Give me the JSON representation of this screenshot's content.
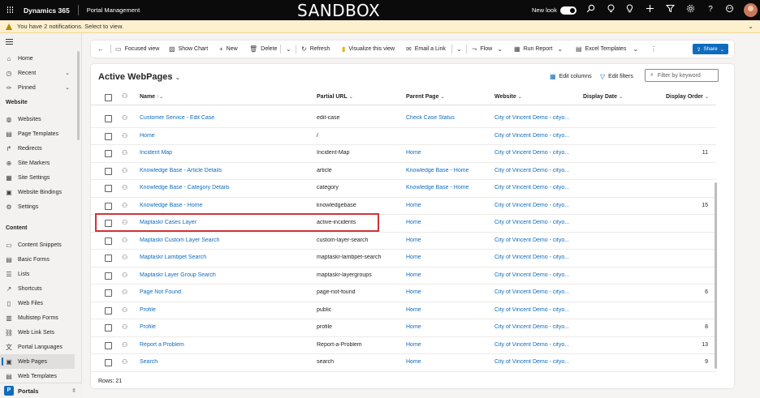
{
  "topbar": {
    "brand": "Dynamics 365",
    "app_name": "Portal Management",
    "environment": "SANDBOX",
    "new_look_label": "New look",
    "new_look_on": true
  },
  "notification": {
    "text": "You have 2 notifications. Select to view."
  },
  "sidebar": {
    "top_items": [
      {
        "label": "Home",
        "icon": "home-icon"
      },
      {
        "label": "Recent",
        "icon": "clock-icon"
      },
      {
        "label": "Pinned",
        "icon": "pin-icon"
      }
    ],
    "website_header": "Website",
    "website_items": [
      {
        "label": "Websites",
        "icon": "globe-icon"
      },
      {
        "label": "Page Templates",
        "icon": "document-icon"
      },
      {
        "label": "Redirects",
        "icon": "redirect-icon"
      },
      {
        "label": "Site Markers",
        "icon": "marker-icon"
      },
      {
        "label": "Site Settings",
        "icon": "settings-icon"
      },
      {
        "label": "Website Bindings",
        "icon": "binding-icon"
      },
      {
        "label": "Settings",
        "icon": "gear-icon"
      }
    ],
    "content_header": "Content",
    "content_items": [
      {
        "label": "Content Snippets",
        "icon": "snippet-icon"
      },
      {
        "label": "Basic Forms",
        "icon": "form-icon"
      },
      {
        "label": "Lists",
        "icon": "list-icon"
      },
      {
        "label": "Shortcuts",
        "icon": "shortcut-icon"
      },
      {
        "label": "Web Files",
        "icon": "file-icon"
      },
      {
        "label": "Multistep Forms",
        "icon": "multistep-icon"
      },
      {
        "label": "Web Link Sets",
        "icon": "link-icon"
      },
      {
        "label": "Portal Languages",
        "icon": "language-icon"
      },
      {
        "label": "Web Pages",
        "icon": "webpage-icon",
        "selected": true
      },
      {
        "label": "Web Templates",
        "icon": "template-icon"
      }
    ],
    "area_badge": "P",
    "area_label": "Portals"
  },
  "commandbar": {
    "focused_view": "Focused view",
    "show_chart": "Show Chart",
    "new": "New",
    "delete": "Delete",
    "refresh": "Refresh",
    "visualize": "Visualize this view",
    "email_link": "Email a Link",
    "flow": "Flow",
    "run_report": "Run Report",
    "excel_templates": "Excel Templates",
    "share": "Share"
  },
  "view": {
    "title": "Active WebPages",
    "edit_columns": "Edit columns",
    "edit_filters": "Edit filters",
    "filter_placeholder": "Filter by keyword",
    "columns": [
      "Name",
      "Partial URL",
      "Parent Page",
      "Website",
      "Display Date",
      "Display Order"
    ],
    "rows": [
      {
        "name": "Customer Service - Edit Case",
        "url": "edit-case",
        "parent": "Check Case Status",
        "website": "City of Vincent Demo - cityo...",
        "date": "",
        "order": ""
      },
      {
        "name": "Home",
        "url": "/",
        "parent": "",
        "website": "City of Vincent Demo - cityo...",
        "date": "",
        "order": ""
      },
      {
        "name": "Incident Map",
        "url": "Incident-Map",
        "parent": "Home",
        "website": "City of Vincent Demo - cityo...",
        "date": "",
        "order": "11"
      },
      {
        "name": "Knowledge Base - Article Details",
        "url": "article",
        "parent": "Knowledge Base - Home",
        "website": "City of Vincent Demo - cityo...",
        "date": "",
        "order": ""
      },
      {
        "name": "Knowledge Base - Category Details",
        "url": "category",
        "parent": "Knowledge Base - Home",
        "website": "City of Vincent Demo - cityo...",
        "date": "",
        "order": ""
      },
      {
        "name": "Knowledge Base - Home",
        "url": "knowledgebase",
        "parent": "Home",
        "website": "City of Vincent Demo - cityo...",
        "date": "",
        "order": "15"
      },
      {
        "name": "Maptaskr Cases Layer",
        "url": "active-incidents",
        "parent": "Home",
        "website": "City of Vincent Demo - cityo...",
        "date": "",
        "order": ""
      },
      {
        "name": "Maptaskr Custom Layer Search",
        "url": "custom-layer-search",
        "parent": "Home",
        "website": "City of Vincent Demo - cityo...",
        "date": "",
        "order": ""
      },
      {
        "name": "Maptaskr Lambpet Search",
        "url": "maptaskr-lambpet-search",
        "parent": "Home",
        "website": "City of Vincent Demo - cityo...",
        "date": "",
        "order": ""
      },
      {
        "name": "Maptaskr Layer Group Search",
        "url": "maptaskr-layergroups",
        "parent": "Home",
        "website": "City of Vincent Demo - cityo...",
        "date": "",
        "order": ""
      },
      {
        "name": "Page Not Found",
        "url": "page-not-found",
        "parent": "Home",
        "website": "City of Vincent Demo - cityo...",
        "date": "",
        "order": "6"
      },
      {
        "name": "Profile",
        "url": "public",
        "parent": "Home",
        "website": "City of Vincent Demo - cityo...",
        "date": "",
        "order": ""
      },
      {
        "name": "Profile",
        "url": "profile",
        "parent": "Home",
        "website": "City of Vincent Demo - cityo...",
        "date": "",
        "order": "8"
      },
      {
        "name": "Report a Problem",
        "url": "Report-a-Problem",
        "parent": "Home",
        "website": "City of Vincent Demo - cityo...",
        "date": "",
        "order": "13"
      },
      {
        "name": "Search",
        "url": "search",
        "parent": "Home",
        "website": "City of Vincent Demo - cityo...",
        "date": "",
        "order": "9"
      }
    ],
    "footer": "Rows: 21"
  },
  "colors": {
    "accent": "#0f6cbd",
    "highlight_box": "#d13438",
    "notification_bg": "#fdf0cf"
  }
}
